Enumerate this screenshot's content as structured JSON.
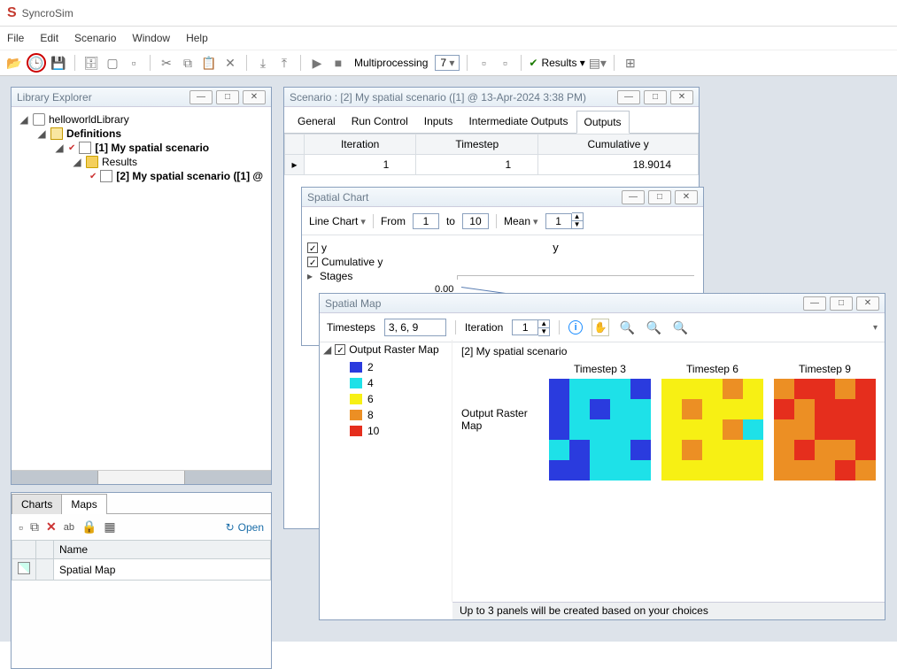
{
  "app": {
    "title": "SyncroSim"
  },
  "menu": [
    "File",
    "Edit",
    "Scenario",
    "Window",
    "Help"
  ],
  "toolbar": {
    "multiprocessing_label": "Multiprocessing",
    "multiprocessing_value": "7",
    "results_label": "Results"
  },
  "library_explorer": {
    "title": "Library Explorer",
    "nodes": {
      "root": "helloworldLibrary",
      "defs": "Definitions",
      "scn1": "[1] My spatial scenario",
      "results": "Results",
      "scn2": "[2] My spatial scenario ([1] @"
    }
  },
  "charts_maps": {
    "tabs": [
      "Charts",
      "Maps"
    ],
    "open_label": "Open",
    "column": "Name",
    "row": "Spatial Map"
  },
  "scenario": {
    "title": "Scenario : [2] My spatial scenario ([1] @ 13-Apr-2024 3:38 PM)",
    "tabs": [
      "General",
      "Run Control",
      "Inputs",
      "Intermediate Outputs",
      "Outputs"
    ],
    "columns": [
      "Iteration",
      "Timestep",
      "Cumulative y"
    ],
    "row": [
      "1",
      "1",
      "18.9014"
    ]
  },
  "spatial_chart": {
    "title": "Spatial Chart",
    "line_chart": "Line Chart",
    "from": "From",
    "from_val": "1",
    "to": "to",
    "to_val": "10",
    "mean": "Mean",
    "mean_val": "1",
    "legend_items": [
      "y",
      "Cumulative y",
      "Stages"
    ],
    "plot_title": "y",
    "ytick": "0.00"
  },
  "spatial_map": {
    "title": "Spatial Map",
    "timesteps_label": "Timesteps",
    "timesteps_value": "3, 6, 9",
    "iteration_label": "Iteration",
    "iteration_value": "1",
    "legend_header": "Output Raster Map",
    "legend": [
      {
        "color": "#2a3bde",
        "label": "2"
      },
      {
        "color": "#1ee1e8",
        "label": "4"
      },
      {
        "color": "#f7f014",
        "label": "6"
      },
      {
        "color": "#ec8f24",
        "label": "8"
      },
      {
        "color": "#e52e1d",
        "label": "10"
      }
    ],
    "scenario_title": "[2] My spatial scenario",
    "row_label": "Output Raster Map",
    "maps": [
      {
        "title": "Timestep 3",
        "cells": [
          "c2",
          "c4",
          "c4",
          "c4",
          "c2",
          "c2",
          "c4",
          "c2",
          "c4",
          "c4",
          "c2",
          "c4",
          "c4",
          "c4",
          "c4",
          "c4",
          "c2",
          "c4",
          "c4",
          "c2",
          "c2",
          "c2",
          "c4",
          "c4",
          "c4"
        ]
      },
      {
        "title": "Timestep 6",
        "cells": [
          "c6",
          "c6",
          "c6",
          "c8",
          "c6",
          "c6",
          "c8",
          "c6",
          "c6",
          "c6",
          "c6",
          "c6",
          "c6",
          "c8",
          "c4",
          "c6",
          "c8",
          "c6",
          "c6",
          "c6",
          "c6",
          "c6",
          "c6",
          "c6",
          "c6"
        ]
      },
      {
        "title": "Timestep 9",
        "cells": [
          "c8",
          "c10",
          "c10",
          "c8",
          "c10",
          "c10",
          "c8",
          "c10",
          "c10",
          "c10",
          "c8",
          "c8",
          "c10",
          "c10",
          "c10",
          "c8",
          "c10",
          "c8",
          "c8",
          "c10",
          "c8",
          "c8",
          "c8",
          "c10",
          "c8"
        ]
      }
    ],
    "status": "Up to 3 panels will be created based on your choices"
  },
  "chart_data": {
    "type": "line",
    "title": "y",
    "x_range": [
      1,
      10
    ],
    "series": [
      {
        "name": "y"
      }
    ],
    "visible_y_tick": 0.0,
    "note": "plot mostly obscured; only title, one y-tick (0.00), and initial downward segment visible"
  }
}
